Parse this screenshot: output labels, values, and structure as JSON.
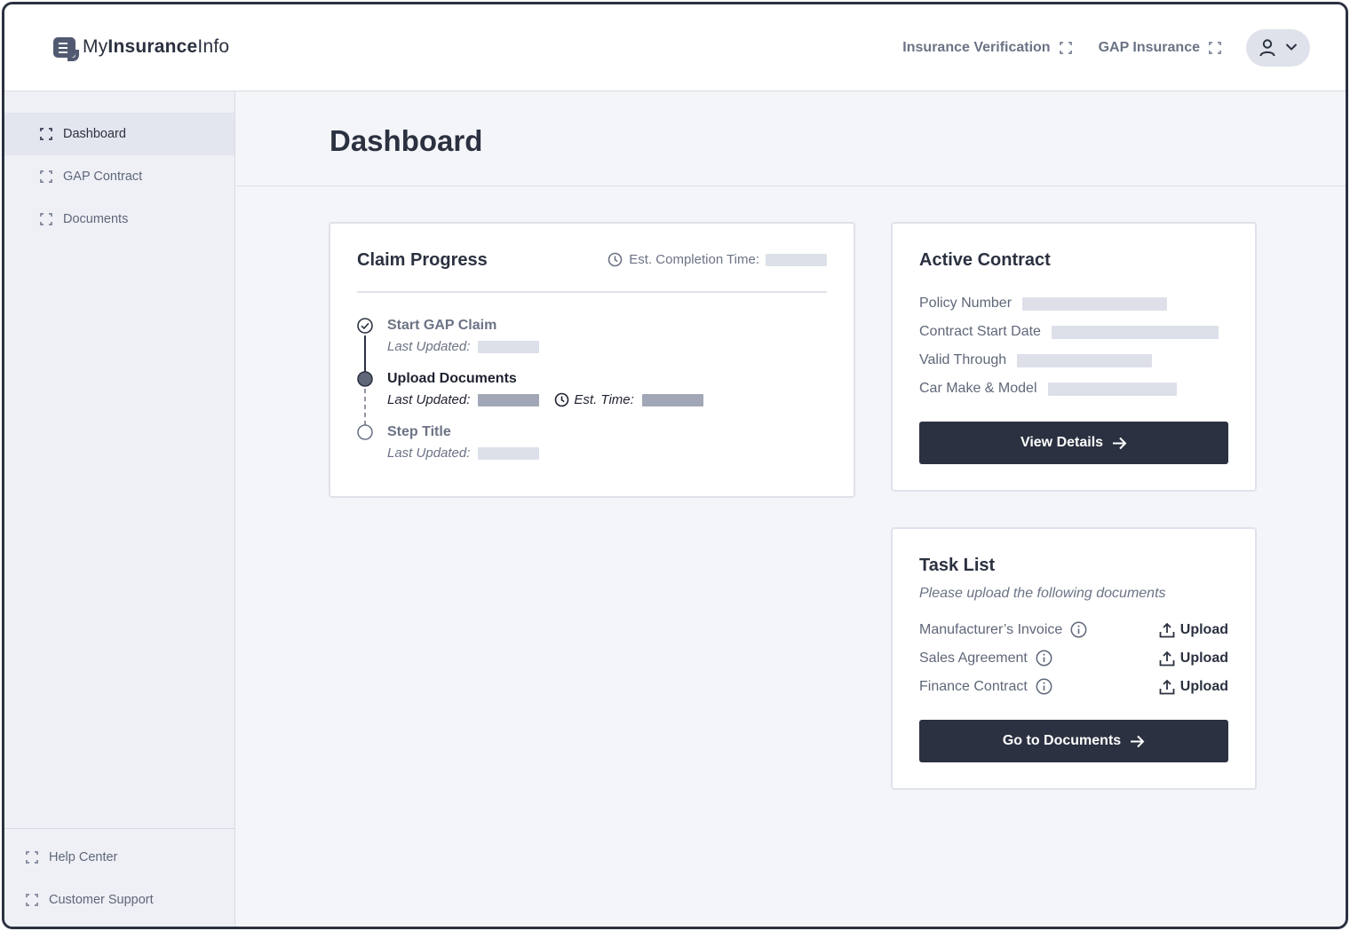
{
  "app": {
    "logo_light_1": "My",
    "logo_bold": "Insurance",
    "logo_light_2": "Info"
  },
  "topnav": {
    "items": [
      {
        "label": "Insurance Verification"
      },
      {
        "label": "GAP Insurance"
      }
    ]
  },
  "sidebar": {
    "items": [
      {
        "label": "Dashboard",
        "active": true
      },
      {
        "label": "GAP Contract"
      },
      {
        "label": "Documents"
      }
    ],
    "bottom_items": [
      {
        "label": "Help Center"
      },
      {
        "label": "Customer Support"
      }
    ]
  },
  "page": {
    "title": "Dashboard"
  },
  "claim_progress": {
    "title": "Claim Progress",
    "est_completion_label": "Est. Completion Time:",
    "steps": [
      {
        "title": "Start GAP Claim",
        "meta_label": "Last Updated:",
        "status": "completed"
      },
      {
        "title": "Upload Documents",
        "meta_label": "Last Updated:",
        "est_label": "Est. Time:",
        "status": "current"
      },
      {
        "title": "Step Title",
        "meta_label": "Last Updated:",
        "status": "pending"
      }
    ]
  },
  "active_contract": {
    "title": "Active Contract",
    "fields": [
      {
        "label": "Policy Number"
      },
      {
        "label": "Contract Start Date"
      },
      {
        "label": "Valid Through"
      },
      {
        "label": "Car Make & Model"
      }
    ],
    "button_label": "View Details"
  },
  "task_list": {
    "title": "Task List",
    "subtitle": "Please upload the following documents",
    "tasks": [
      {
        "name": "Manufacturer’s Invoice",
        "action": "Upload"
      },
      {
        "name": "Sales Agreement",
        "action": "Upload"
      },
      {
        "name": "Finance Contract",
        "action": "Upload"
      }
    ],
    "button_label": "Go to Documents"
  },
  "colors": {
    "primary_dark": "#2b3140",
    "background": "#f4f5f9",
    "sidebar_bg": "#eef0f6",
    "muted_text": "#6b7385",
    "placeholder": "#dde0e9"
  },
  "icons": {
    "nav_placeholder": "corner-brackets-icon",
    "profile": "user-icon",
    "dropdown": "chevron-down-icon",
    "clock": "clock-icon",
    "info": "info-icon",
    "upload": "upload-icon",
    "arrow": "arrow-right-icon"
  }
}
